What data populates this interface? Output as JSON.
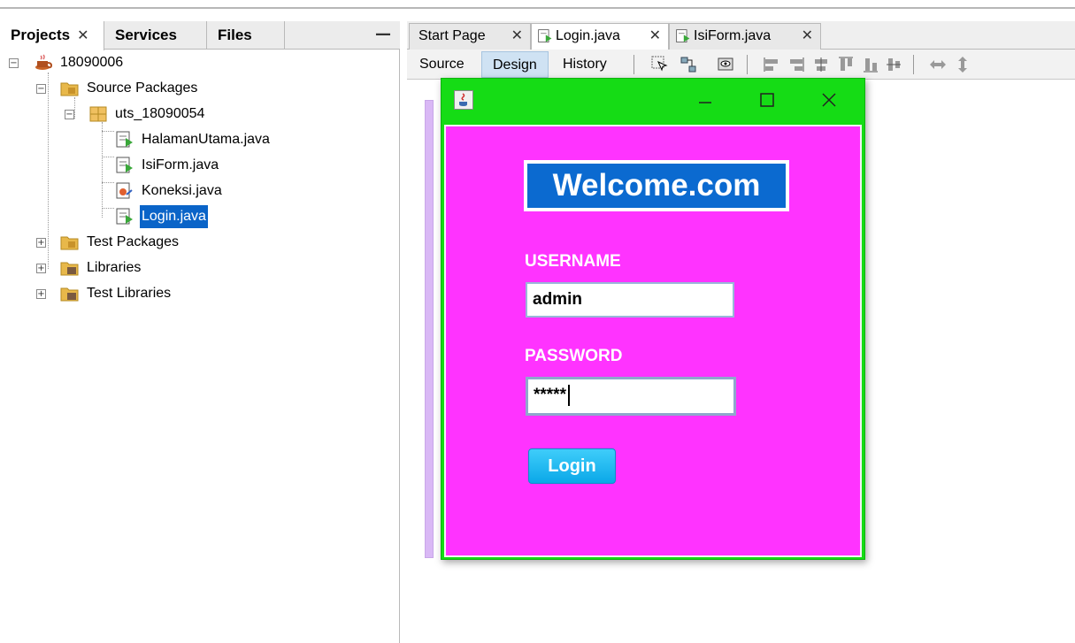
{
  "left_panel": {
    "tabs": [
      {
        "label": "Projects",
        "close": "✕"
      },
      {
        "label": "Services"
      },
      {
        "label": "Files"
      }
    ],
    "minimize": "—",
    "tree": {
      "project": "18090006",
      "source_packages": "Source Packages",
      "package": "uts_18090054",
      "files": [
        "HalamanUtama.java",
        "IsiForm.java",
        "Koneksi.java",
        "Login.java"
      ],
      "test_packages": "Test Packages",
      "libraries": "Libraries",
      "test_libraries": "Test Libraries"
    }
  },
  "editor": {
    "tabs": [
      {
        "label": "Start Page",
        "close": "✕"
      },
      {
        "label": "Login.java",
        "close": "✕"
      },
      {
        "label": "IsiForm.java",
        "close": "✕"
      }
    ],
    "views": [
      "Source",
      "Design",
      "History"
    ],
    "active_view": "Design"
  },
  "window": {
    "controls": {
      "minimize": "—",
      "maximize": "☐",
      "close": "✕"
    },
    "heading": "Welcome.com",
    "username_label": "USERNAME",
    "username_value": "admin",
    "password_label": "PASSWORD",
    "password_value": "*****",
    "login_label": "Login"
  },
  "colors": {
    "selection": "#0a64c8",
    "window_frame": "#15dc15",
    "form_background": "#ff33ff",
    "heading_background": "#0b6ad0",
    "button": "#1eb8f0"
  }
}
